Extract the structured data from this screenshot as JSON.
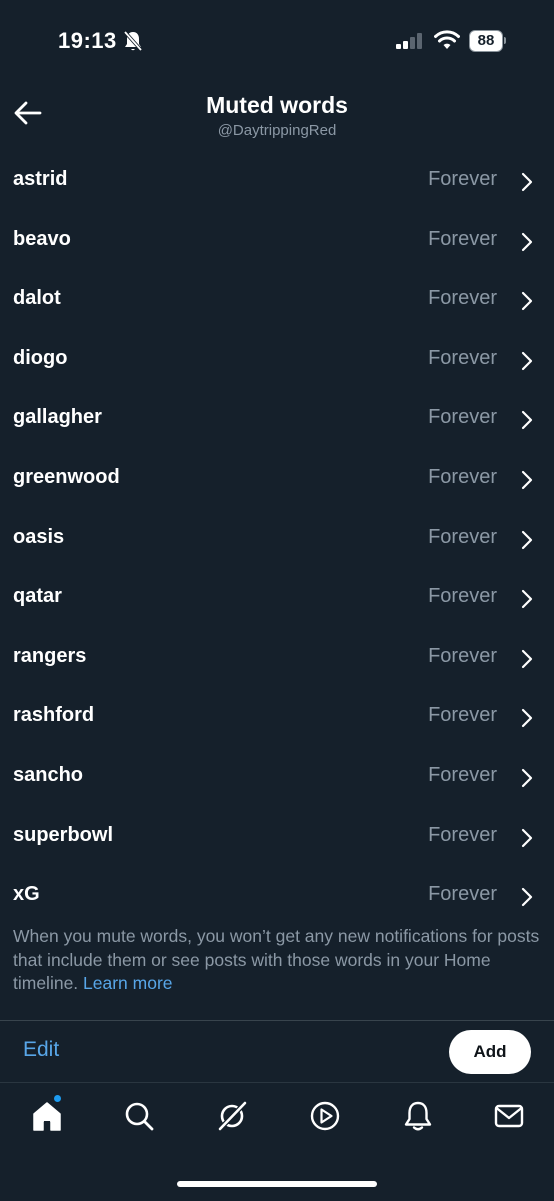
{
  "status_bar": {
    "time": "19:13",
    "battery": "88",
    "icons": [
      "bell-off-icon",
      "signal-icon",
      "wifi-icon",
      "battery-icon"
    ]
  },
  "header": {
    "title": "Muted words",
    "subtitle": "@DaytrippingRed",
    "back_icon": "arrow-left-icon"
  },
  "muted_words": [
    {
      "word": "astrid",
      "duration": "Forever"
    },
    {
      "word": "beavo",
      "duration": "Forever"
    },
    {
      "word": "dalot",
      "duration": "Forever"
    },
    {
      "word": "diogo",
      "duration": "Forever"
    },
    {
      "word": "gallagher",
      "duration": "Forever"
    },
    {
      "word": "greenwood",
      "duration": "Forever"
    },
    {
      "word": "oasis",
      "duration": "Forever"
    },
    {
      "word": "qatar",
      "duration": "Forever"
    },
    {
      "word": "rangers",
      "duration": "Forever"
    },
    {
      "word": "rashford",
      "duration": "Forever"
    },
    {
      "word": "sancho",
      "duration": "Forever"
    },
    {
      "word": "superbowl",
      "duration": "Forever"
    },
    {
      "word": "xG",
      "duration": "Forever"
    }
  ],
  "footnote": {
    "text": "When you mute words, you won’t get any new notifications for posts that include them or see posts with those words in your Home timeline.",
    "link": "Learn more"
  },
  "actions": {
    "edit_label": "Edit",
    "add_label": "Add"
  },
  "bottom_nav": {
    "items": [
      "home-icon",
      "search-icon",
      "grok-icon",
      "video-icon",
      "notifications-icon",
      "messages-icon"
    ]
  },
  "colors": {
    "background": "#15202b",
    "accent": "#58a6e8",
    "secondary_text": "#8b98a5",
    "badge": "#1d9bf0"
  }
}
